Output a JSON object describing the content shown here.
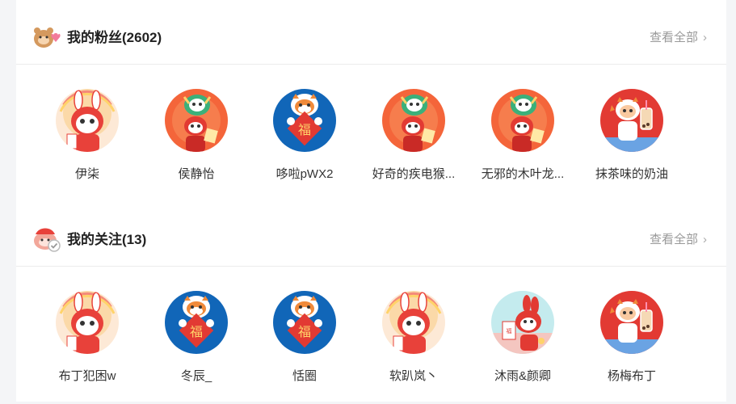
{
  "fans": {
    "title": "我的粉丝(2602)",
    "view_all": "查看全部",
    "users": [
      {
        "name": "伊柒",
        "avatar": "rabbit-cream"
      },
      {
        "name": "侯静怡",
        "avatar": "lion-dance-red"
      },
      {
        "name": "哆啦pWX2",
        "avatar": "tiger-fu-blue"
      },
      {
        "name": "好奇的疾电猴...",
        "avatar": "lion-dance-red"
      },
      {
        "name": "无邪的木叶龙...",
        "avatar": "lion-dance-red"
      },
      {
        "name": "抹茶味的奶油",
        "avatar": "tiger-milktea-red"
      }
    ]
  },
  "follows": {
    "title": "我的关注(13)",
    "view_all": "查看全部",
    "users": [
      {
        "name": "布丁犯困w",
        "avatar": "rabbit-cream"
      },
      {
        "name": "冬辰_",
        "avatar": "tiger-fu-blue"
      },
      {
        "name": "恬圈",
        "avatar": "tiger-fu-blue"
      },
      {
        "name": "软趴岚丶",
        "avatar": "rabbit-cream"
      },
      {
        "name": "沐雨&颜卿",
        "avatar": "rabbit-teal"
      },
      {
        "name": "杨梅布丁",
        "avatar": "tiger-milktea-red"
      }
    ]
  },
  "colors": {
    "accent_red": "#e8413a",
    "blue": "#1166b8",
    "cream": "#fbe7d6",
    "teal": "#bfe7ea"
  }
}
